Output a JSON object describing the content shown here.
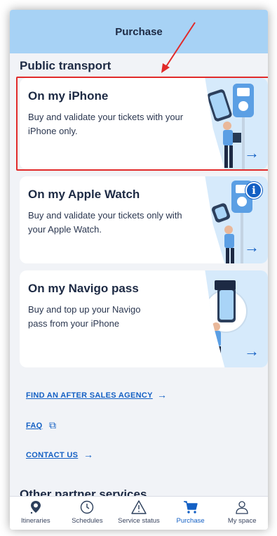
{
  "header": {
    "title": "Purchase"
  },
  "section": {
    "title": "Public transport"
  },
  "cards": [
    {
      "title": "On my iPhone",
      "desc": "Buy and validate your tickets with your iPhone only.",
      "arrow": "→"
    },
    {
      "title": "On my Apple Watch",
      "desc": "Buy and validate your tickets only with your Apple Watch.",
      "arrow": "→",
      "info": "i"
    },
    {
      "title": "On my Navigo pass",
      "desc": "Buy and top up your Navigo pass from your iPhone",
      "arrow": "→"
    }
  ],
  "links": [
    {
      "label": "FIND AN AFTER SALES AGENCY",
      "suffix": "→"
    },
    {
      "label": "FAQ",
      "suffix": "⧉"
    },
    {
      "label": "CONTACT US",
      "suffix": "→"
    }
  ],
  "other": {
    "title": "Other partner services"
  },
  "tabs": [
    {
      "label": "Itineraries",
      "icon": "pin-icon"
    },
    {
      "label": "Schedules",
      "icon": "clock-icon"
    },
    {
      "label": "Service status",
      "icon": "warning-icon"
    },
    {
      "label": "Purchase",
      "icon": "cart-icon",
      "active": true
    },
    {
      "label": "My space",
      "icon": "person-icon"
    }
  ],
  "colors": {
    "accent": "#1460c4",
    "header": "#a7d2f5",
    "highlight": "#e12a2a"
  }
}
